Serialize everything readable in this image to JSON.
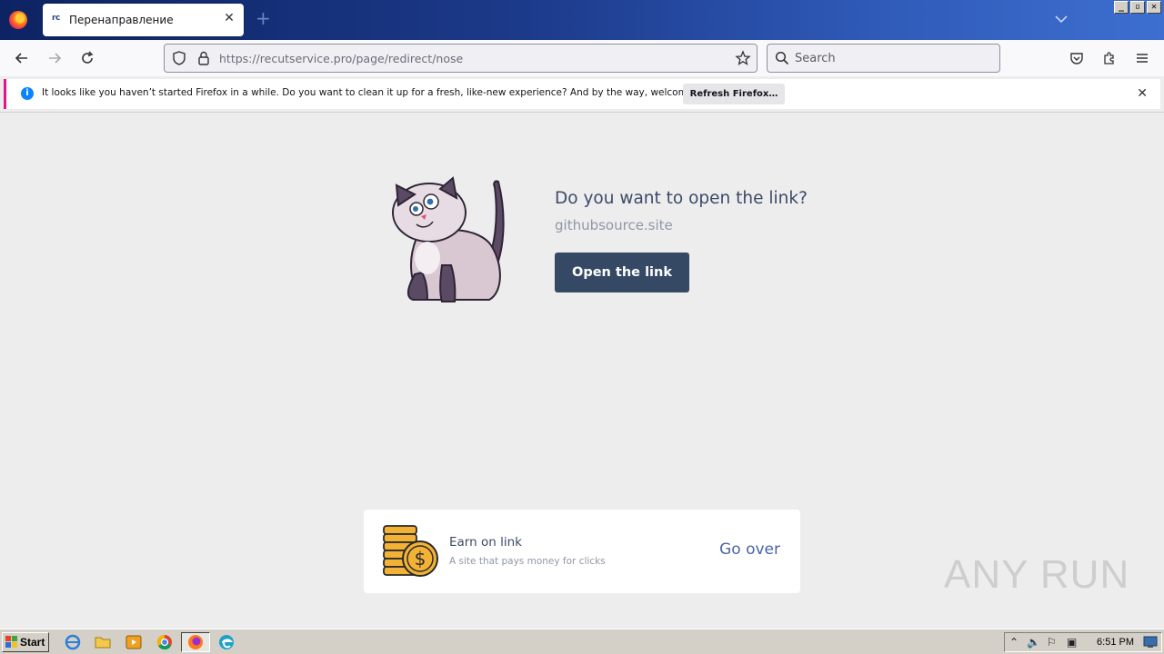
{
  "browser": {
    "tab_favicon": "rc",
    "tab_title": "Перенаправление",
    "url_host": "https://recutservice.pro",
    "url_path": "/page/redirect/nose",
    "search_placeholder": "Search"
  },
  "notification": {
    "text": "It looks like you haven’t started Firefox in a while. Do you want to clean it up for a fresh, like-new experience? And by the way, welcome back!",
    "button": "Refresh Firefox…"
  },
  "page": {
    "prompt_title": "Do you want to open the link?",
    "prompt_domain": "githubsource.site",
    "open_button": "Open the link",
    "ad": {
      "title": "Earn on link",
      "subtitle": "A site that pays money for clicks",
      "action": "Go over"
    },
    "watermark": "ANY RUN"
  },
  "taskbar": {
    "start_label": "Start",
    "time": "6:51 PM"
  },
  "colors": {
    "primary_button": "#354965",
    "heading": "#3d4a66",
    "muted": "#9097a6",
    "link": "#4b64a8",
    "page_bg": "#ededee"
  }
}
